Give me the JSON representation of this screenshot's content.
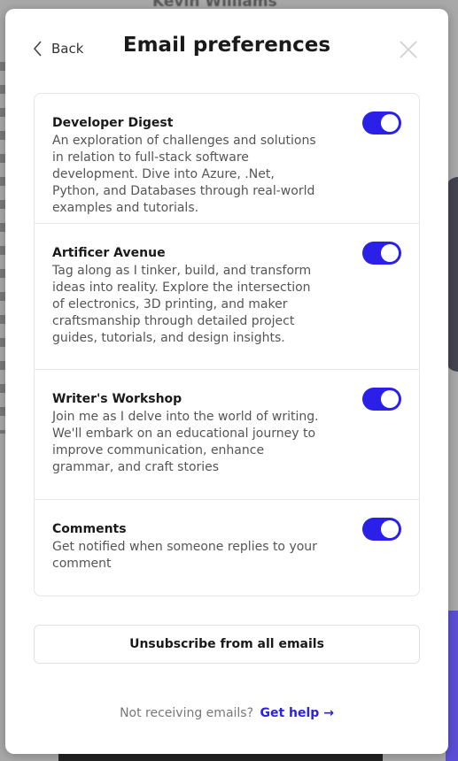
{
  "background": {
    "name": "Kevin Williams"
  },
  "header": {
    "back_label": "Back",
    "title": "Email preferences"
  },
  "preferences": [
    {
      "name": "Developer Digest",
      "description": "An exploration of challenges and solutions in relation to full-stack software development. Dive into Azure, .Net, Python, and Databases through real-world examples and tutorials.",
      "enabled": true
    },
    {
      "name": "Artificer Avenue",
      "description": "Tag along as I tinker, build, and transform ideas into reality. Explore the intersection of electronics, 3D printing, and maker craftsmanship through detailed project guides, tutorials, and design insights.",
      "enabled": true
    },
    {
      "name": "Writer's Workshop",
      "description": "Join me as I delve into the world of writing. We'll embark on an educational journey to improve communication, enhance grammar, and craft stories",
      "enabled": true
    },
    {
      "name": "Comments",
      "description": "Get notified when someone replies to your comment",
      "enabled": true
    }
  ],
  "unsubscribe_label": "Unsubscribe from all emails",
  "help": {
    "prefix": "Not receiving emails?",
    "link_label": "Get help →"
  },
  "colors": {
    "accent": "#2a20e8"
  }
}
